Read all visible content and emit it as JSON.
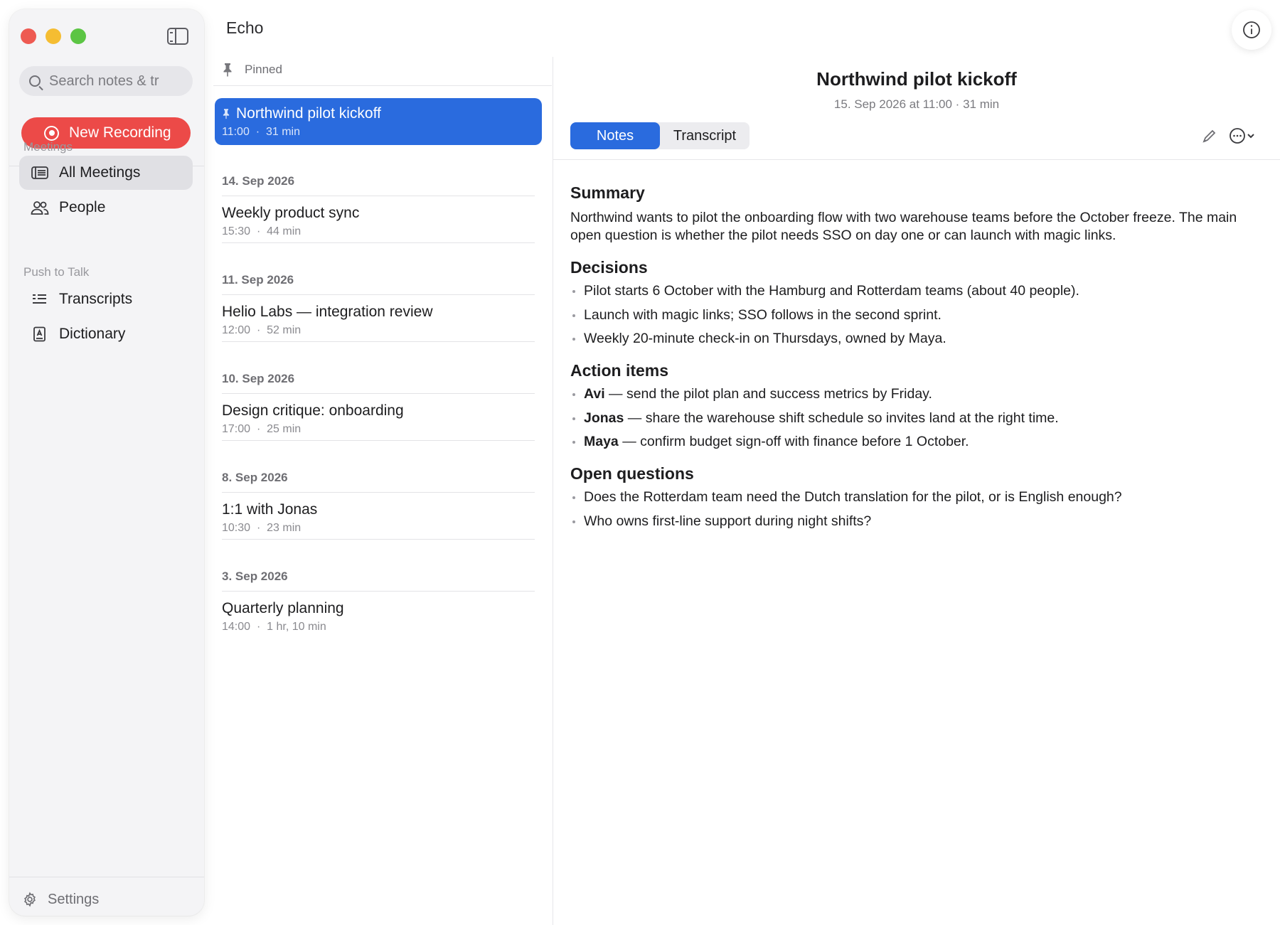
{
  "app": {
    "title": "Echo"
  },
  "sidebar": {
    "search": {
      "placeholder": "Search notes & tr"
    },
    "new_recording_label": "New Recording",
    "sections": [
      {
        "label": "Meetings",
        "items": [
          {
            "label": "All Meetings",
            "icon": "list-icon",
            "active": true
          },
          {
            "label": "People",
            "icon": "people-icon",
            "active": false
          }
        ]
      },
      {
        "label": "Push to Talk",
        "items": [
          {
            "label": "Transcripts",
            "icon": "transcripts-icon",
            "active": false
          },
          {
            "label": "Dictionary",
            "icon": "dictionary-icon",
            "active": false
          }
        ]
      }
    ],
    "settings_label": "Settings"
  },
  "list": {
    "pinned_label": "Pinned",
    "pinned": [
      {
        "title": "Northwind pilot kickoff",
        "time": "11:00",
        "duration": "31 min"
      }
    ],
    "groups": [
      {
        "date": "14. Sep 2026",
        "items": [
          {
            "title": "Weekly product sync",
            "time": "15:30",
            "duration": "44 min"
          }
        ]
      },
      {
        "date": "11. Sep 2026",
        "items": [
          {
            "title": "Helio Labs — integration review",
            "time": "12:00",
            "duration": "52 min"
          }
        ]
      },
      {
        "date": "10. Sep 2026",
        "items": [
          {
            "title": "Design critique: onboarding",
            "time": "17:00",
            "duration": "25 min"
          }
        ]
      },
      {
        "date": "8. Sep 2026",
        "items": [
          {
            "title": "1:1 with Jonas",
            "time": "10:30",
            "duration": "23 min"
          }
        ]
      },
      {
        "date": "3. Sep 2026",
        "items": [
          {
            "title": "Quarterly planning",
            "time": "14:00",
            "duration": "1 hr, 10 min"
          }
        ]
      }
    ]
  },
  "detail": {
    "title": "Northwind pilot kickoff",
    "meta": "15. Sep 2026 at 11:00 · 31 min",
    "tabs": {
      "notes": "Notes",
      "transcript": "Transcript"
    },
    "summary": {
      "heading": "Summary",
      "text": "Northwind wants to pilot the onboarding flow with two warehouse teams before the October freeze. The main open question is whether the pilot needs SSO on day one or can launch with magic links."
    },
    "decisions": {
      "heading": "Decisions",
      "items": [
        "Pilot starts 6 October with the Hamburg and Rotterdam teams (about 40 people).",
        "Launch with magic links; SSO follows in the second sprint.",
        "Weekly 20-minute check-in on Thursdays, owned by Maya."
      ]
    },
    "action_items": {
      "heading": "Action items",
      "items": [
        {
          "owner": "Avi",
          "text": " — send the pilot plan and success metrics by Friday."
        },
        {
          "owner": "Jonas",
          "text": " — share the warehouse shift schedule so invites land at the right time."
        },
        {
          "owner": "Maya",
          "text": " — confirm budget sign-off with finance before 1 October."
        }
      ]
    },
    "open_questions": {
      "heading": "Open questions",
      "items": [
        "Does the Rotterdam team need the Dutch translation for the pilot, or is English enough?",
        "Who owns first-line support during night shifts?"
      ]
    }
  },
  "colors": {
    "accent": "#2a6bde",
    "record": "#ec4a48",
    "sidebar_bg": "#f4f4f6"
  }
}
